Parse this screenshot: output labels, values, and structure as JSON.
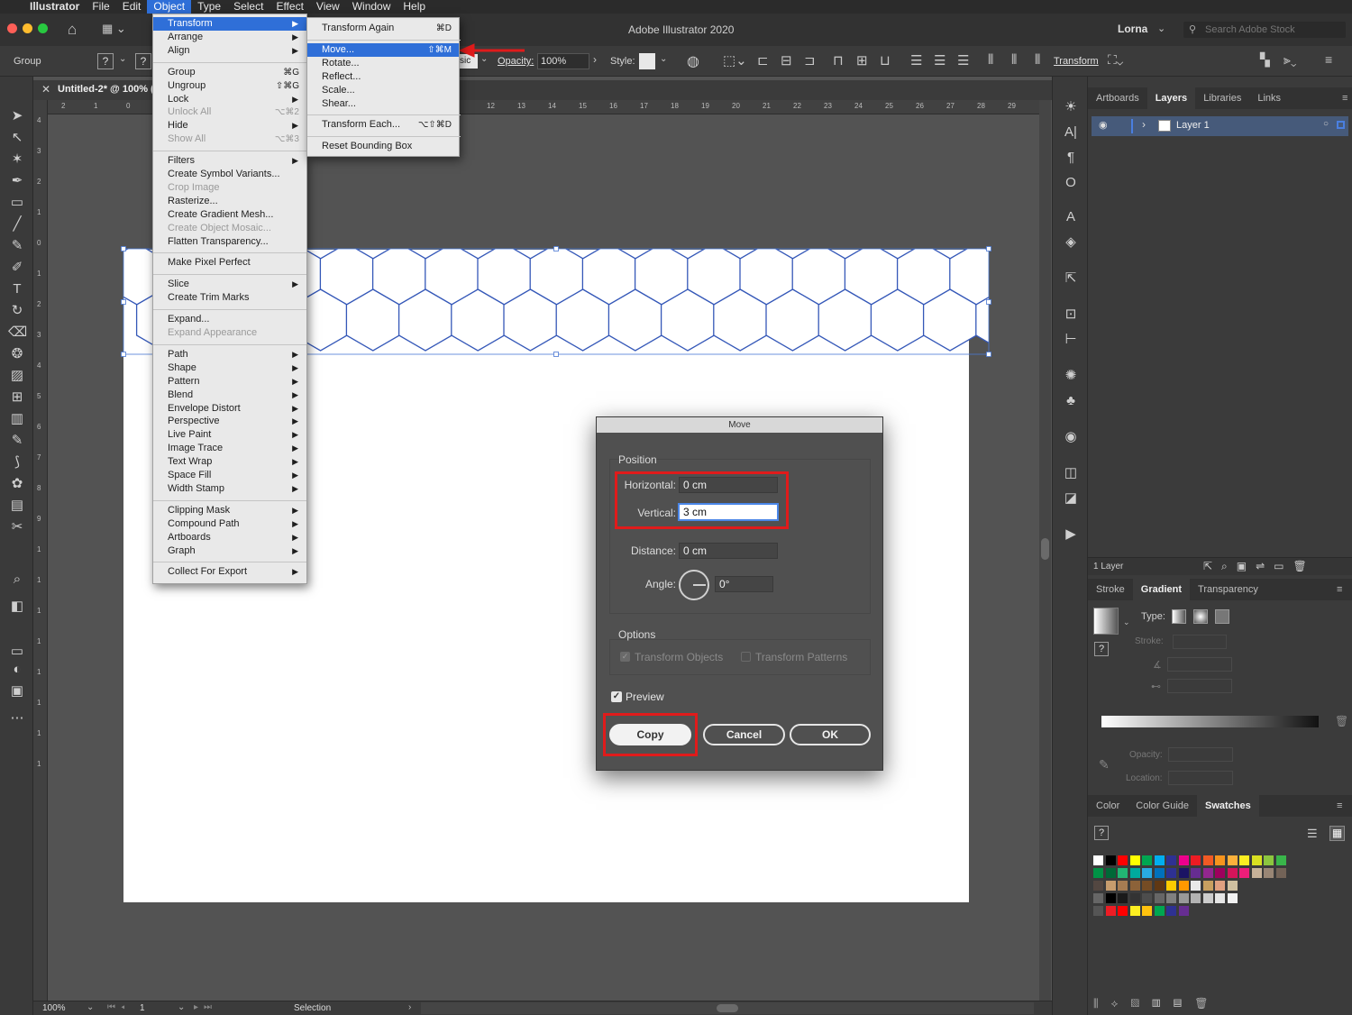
{
  "macbar": {
    "app": "Illustrator",
    "menus": [
      "File",
      "Edit",
      "Object",
      "Type",
      "Select",
      "Effect",
      "View",
      "Window",
      "Help"
    ],
    "active_menu": "Object"
  },
  "titlebar": {
    "title": "Adobe Illustrator 2020",
    "user": "Lorna",
    "search_placeholder": "Search Adobe Stock"
  },
  "controlbar": {
    "selection_label": "Group",
    "mode_text": "sic",
    "opacity_label": "Opacity:",
    "opacity_value": "100%",
    "style_label": "Style:",
    "transform_label": "Transform"
  },
  "doc": {
    "tab_title": "Untitled-2* @ 100% ("
  },
  "ruler": {
    "h_ticks": [
      "2",
      "1",
      "0",
      "12",
      "13",
      "14",
      "15",
      "16",
      "17",
      "18",
      "19",
      "20",
      "21",
      "22",
      "23",
      "24",
      "25",
      "26",
      "27",
      "28",
      "29"
    ],
    "v_ticks": [
      "4",
      "3",
      "2",
      "1",
      "0",
      "1",
      "2",
      "3",
      "4",
      "5",
      "6",
      "7",
      "8",
      "9",
      "1",
      "1",
      "1",
      "1",
      "1",
      "1",
      "1",
      "1"
    ]
  },
  "object_menu": {
    "items": [
      {
        "label": "Transform",
        "arrow": true,
        "highlight": true
      },
      {
        "label": "Arrange",
        "arrow": true
      },
      {
        "label": "Align",
        "arrow": true
      },
      {
        "sep": true
      },
      {
        "label": "Group",
        "shortcut": "⌘G"
      },
      {
        "label": "Ungroup",
        "shortcut": "⇧⌘G"
      },
      {
        "label": "Lock",
        "arrow": true
      },
      {
        "label": "Unlock All",
        "shortcut": "⌥⌘2",
        "disabled": true
      },
      {
        "label": "Hide",
        "arrow": true
      },
      {
        "label": "Show All",
        "shortcut": "⌥⌘3",
        "disabled": true
      },
      {
        "sep": true
      },
      {
        "label": "Filters",
        "arrow": true
      },
      {
        "label": "Create Symbol Variants..."
      },
      {
        "label": "Crop Image",
        "disabled": true
      },
      {
        "label": "Rasterize..."
      },
      {
        "label": "Create Gradient Mesh..."
      },
      {
        "label": "Create Object Mosaic...",
        "disabled": true
      },
      {
        "label": "Flatten Transparency..."
      },
      {
        "sep": true
      },
      {
        "label": "Make Pixel Perfect"
      },
      {
        "sep": true
      },
      {
        "label": "Slice",
        "arrow": true
      },
      {
        "label": "Create Trim Marks"
      },
      {
        "sep": true
      },
      {
        "label": "Expand..."
      },
      {
        "label": "Expand Appearance",
        "disabled": true
      },
      {
        "sep": true
      },
      {
        "label": "Path",
        "arrow": true
      },
      {
        "label": "Shape",
        "arrow": true
      },
      {
        "label": "Pattern",
        "arrow": true
      },
      {
        "label": "Blend",
        "arrow": true
      },
      {
        "label": "Envelope Distort",
        "arrow": true
      },
      {
        "label": "Perspective",
        "arrow": true
      },
      {
        "label": "Live Paint",
        "arrow": true
      },
      {
        "label": "Image Trace",
        "arrow": true
      },
      {
        "label": "Text Wrap",
        "arrow": true
      },
      {
        "label": "Space Fill",
        "arrow": true
      },
      {
        "label": "Width Stamp",
        "arrow": true
      },
      {
        "sep": true
      },
      {
        "label": "Clipping Mask",
        "arrow": true
      },
      {
        "label": "Compound Path",
        "arrow": true
      },
      {
        "label": "Artboards",
        "arrow": true
      },
      {
        "label": "Graph",
        "arrow": true
      },
      {
        "sep": true
      },
      {
        "label": "Collect For Export",
        "arrow": true
      }
    ]
  },
  "transform_submenu": {
    "items": [
      {
        "label": "Transform Again",
        "shortcut": "⌘D"
      },
      {
        "sep": true
      },
      {
        "label": "Move...",
        "shortcut": "⇧⌘M",
        "highlight": true
      },
      {
        "label": "Rotate..."
      },
      {
        "label": "Reflect..."
      },
      {
        "label": "Scale..."
      },
      {
        "label": "Shear..."
      },
      {
        "sep": true
      },
      {
        "label": "Transform Each...",
        "shortcut": "⌥⇧⌘D"
      },
      {
        "sep": true
      },
      {
        "label": "Reset Bounding Box"
      }
    ]
  },
  "move_dialog": {
    "title": "Move",
    "position_heading": "Position",
    "horizontal_label": "Horizontal:",
    "horizontal_value": "0 cm",
    "vertical_label": "Vertical:",
    "vertical_value": "3 cm",
    "distance_label": "Distance:",
    "distance_value": "0 cm",
    "angle_label": "Angle:",
    "angle_value": "0°",
    "options_heading": "Options",
    "transform_objects": "Transform Objects",
    "transform_patterns": "Transform Patterns",
    "preview_label": "Preview",
    "copy_button": "Copy",
    "cancel_button": "Cancel",
    "ok_button": "OK"
  },
  "layers_panel": {
    "tabs": [
      "Artboards",
      "Layers",
      "Libraries",
      "Links"
    ],
    "active_tab": "Layers",
    "layer_name": "Layer 1",
    "footer": "1 Layer"
  },
  "gradient_panel": {
    "tabs": [
      "Stroke",
      "Gradient",
      "Transparency"
    ],
    "active_tab": "Gradient",
    "type_label": "Type:",
    "stroke_label": "Stroke:",
    "opacity_label": "Opacity:",
    "location_label": "Location:"
  },
  "swatches_panel": {
    "tabs": [
      "Color",
      "Color Guide",
      "Swatches"
    ],
    "active_tab": "Swatches",
    "rows": [
      [
        "#ffffff",
        "#000000",
        "#ff0000",
        "#ffff00",
        "#00a651",
        "#00aeef",
        "#2e3192",
        "#ec008c",
        "#ed1c24",
        "#f15a24",
        "#f7941d",
        "#fbb03b",
        "#fcee21",
        "#d9e021",
        "#8cc63f",
        "#39b54a"
      ],
      [
        "#009245",
        "#006837",
        "#22b573",
        "#00a99d",
        "#29abe2",
        "#0071bc",
        "#2e3192",
        "#1b1464",
        "#662d91",
        "#93278f",
        "#9e005d",
        "#d4145a",
        "#ed1e79",
        "#c7b299",
        "#998675",
        "#736357"
      ],
      [
        "#534741",
        "#c69c6d",
        "#a67c52",
        "#8c6239",
        "#754c24",
        "#603813",
        "#ffcc00",
        "#ff9900",
        "#e8e8e8",
        "#c8a060",
        "#e0a080",
        "#d0c0a0"
      ],
      [
        "#666666",
        "#000000",
        "#1a1a1a",
        "#333333",
        "#4d4d4d",
        "#666666",
        "#808080",
        "#999999",
        "#b3b3b3",
        "#cccccc",
        "#e6e6e6",
        "#f2f2f2"
      ],
      [
        "#555555",
        "#ed1c24",
        "#ff0000",
        "#fcee21",
        "#ffc20e",
        "#00a651",
        "#2e3192",
        "#662d91"
      ]
    ]
  },
  "statusbar": {
    "zoom": "100%",
    "artboard_num": "1",
    "tool": "Selection"
  },
  "colors": {
    "accent": "#2f6fd8",
    "callout": "#e01b1b",
    "hexagon_stroke": "#3558b8"
  }
}
